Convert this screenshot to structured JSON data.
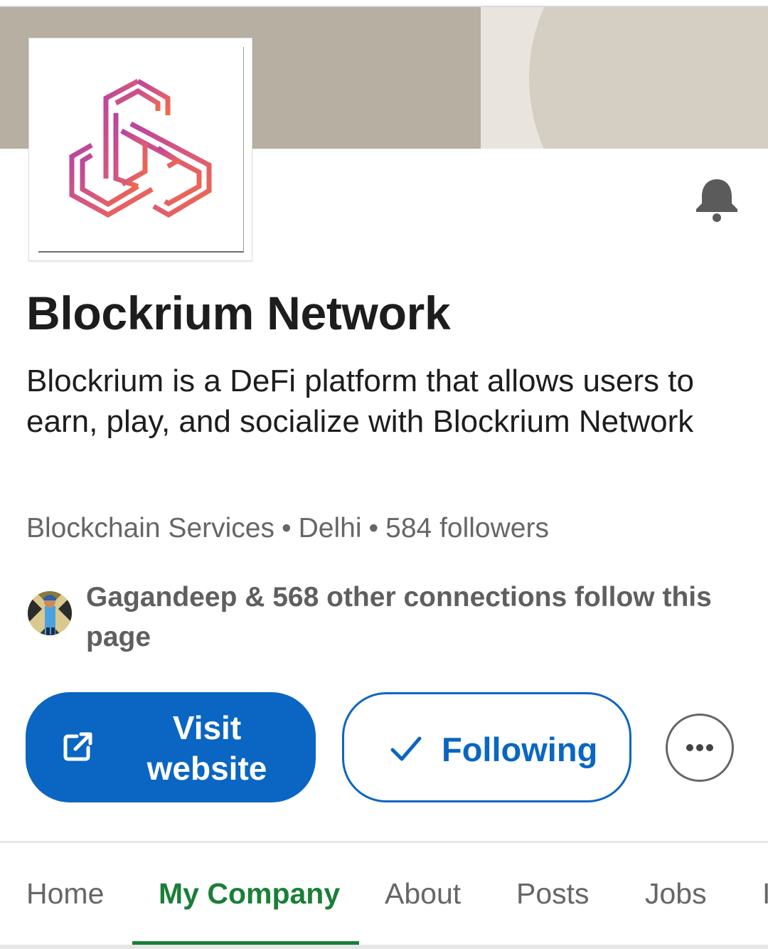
{
  "company": {
    "name": "Blockrium Network",
    "tagline": "Blockrium is a DeFi platform that allows users to earn, play, and socialize with Blockrium Network",
    "industry": "Blockchain Services",
    "location": "Delhi",
    "followers": "584 followers",
    "separator": "•"
  },
  "connections": {
    "text": "Gagandeep & 568 other connections follow this page"
  },
  "actions": {
    "visit_website": "Visit website",
    "following": "Following",
    "more_icon": "more-horizontal-icon",
    "visit_icon": "external-link-icon",
    "following_icon": "checkmark-icon"
  },
  "notifications": {
    "icon": "bell-icon"
  },
  "tabs": [
    {
      "label": "Home",
      "active": false
    },
    {
      "label": "My Company",
      "active": true
    },
    {
      "label": "About",
      "active": false
    },
    {
      "label": "Posts",
      "active": false
    },
    {
      "label": "Jobs",
      "active": false
    },
    {
      "label": "I",
      "active": false
    }
  ],
  "colors": {
    "primary_blue": "#0a66c2",
    "active_tab_green": "#1a7f37",
    "banner_taupe": "#b6afa2",
    "logo_gradient_start": "#c0449a",
    "logo_gradient_end": "#f0674c"
  }
}
